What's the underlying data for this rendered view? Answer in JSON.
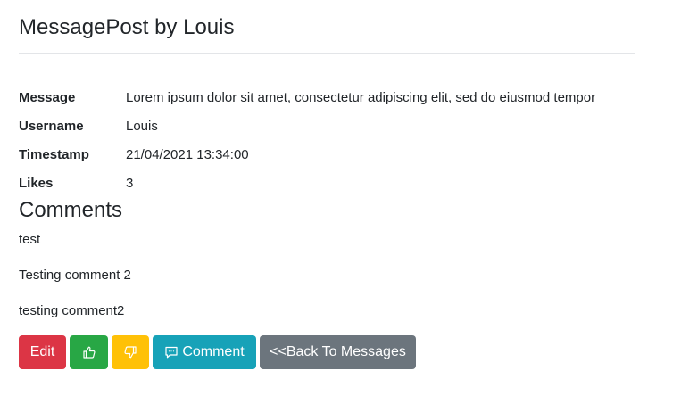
{
  "page": {
    "title": "MessagePost by Louis"
  },
  "details": {
    "rows": [
      {
        "label": "Message",
        "value": "Lorem ipsum dolor sit amet, consectetur adipiscing elit, sed do eiusmod tempor"
      },
      {
        "label": "Username",
        "value": "Louis"
      },
      {
        "label": "Timestamp",
        "value": "21/04/2021 13:34:00"
      },
      {
        "label": "Likes",
        "value": "3"
      }
    ]
  },
  "comments": {
    "heading": "Comments",
    "items": [
      "test",
      "Testing comment 2",
      "testing comment2"
    ]
  },
  "actions": {
    "edit_label": "Edit",
    "like_icon": "thumbs-up-icon",
    "dislike_icon": "thumbs-down-icon",
    "comment_label": "Comment",
    "comment_icon": "chat-dots-icon",
    "back_label": "<<Back To Messages"
  },
  "colors": {
    "edit": "#dc3545",
    "like": "#28a745",
    "dislike": "#ffc107",
    "comment": "#17a2b8",
    "back": "#6c757d"
  }
}
